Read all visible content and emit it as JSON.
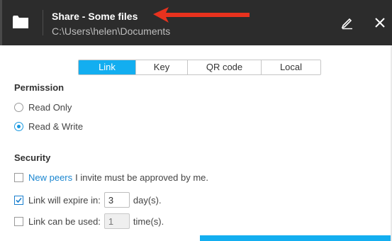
{
  "window": {
    "title": "Share - Some files",
    "path": "C:\\Users\\helen\\Documents",
    "icons": {
      "folder": "folder-icon",
      "edit": "pencil-icon",
      "close": "close-icon",
      "annotation": "red-arrow"
    }
  },
  "tabs": [
    {
      "label": "Link",
      "active": true
    },
    {
      "label": "Key",
      "active": false
    },
    {
      "label": "QR code",
      "active": false
    },
    {
      "label": "Local",
      "active": false
    }
  ],
  "permission": {
    "heading": "Permission",
    "options": [
      {
        "label": "Read Only",
        "checked": false
      },
      {
        "label": "Read & Write",
        "checked": true
      }
    ]
  },
  "security": {
    "heading": "Security",
    "new_peers": {
      "checked": false,
      "link": "New peers",
      "text": "I invite must be approved by me."
    },
    "expire": {
      "checked": true,
      "label": "Link will expire in:",
      "value": "3",
      "unit": "day(s)."
    },
    "uses": {
      "checked": false,
      "label": "Link can be used:",
      "value": "1",
      "unit": "time(s)."
    }
  },
  "colors": {
    "accent": "#13aef0",
    "titlebar": "#2c2c2c",
    "arrow": "#e8321e",
    "link": "#1a86d0"
  }
}
